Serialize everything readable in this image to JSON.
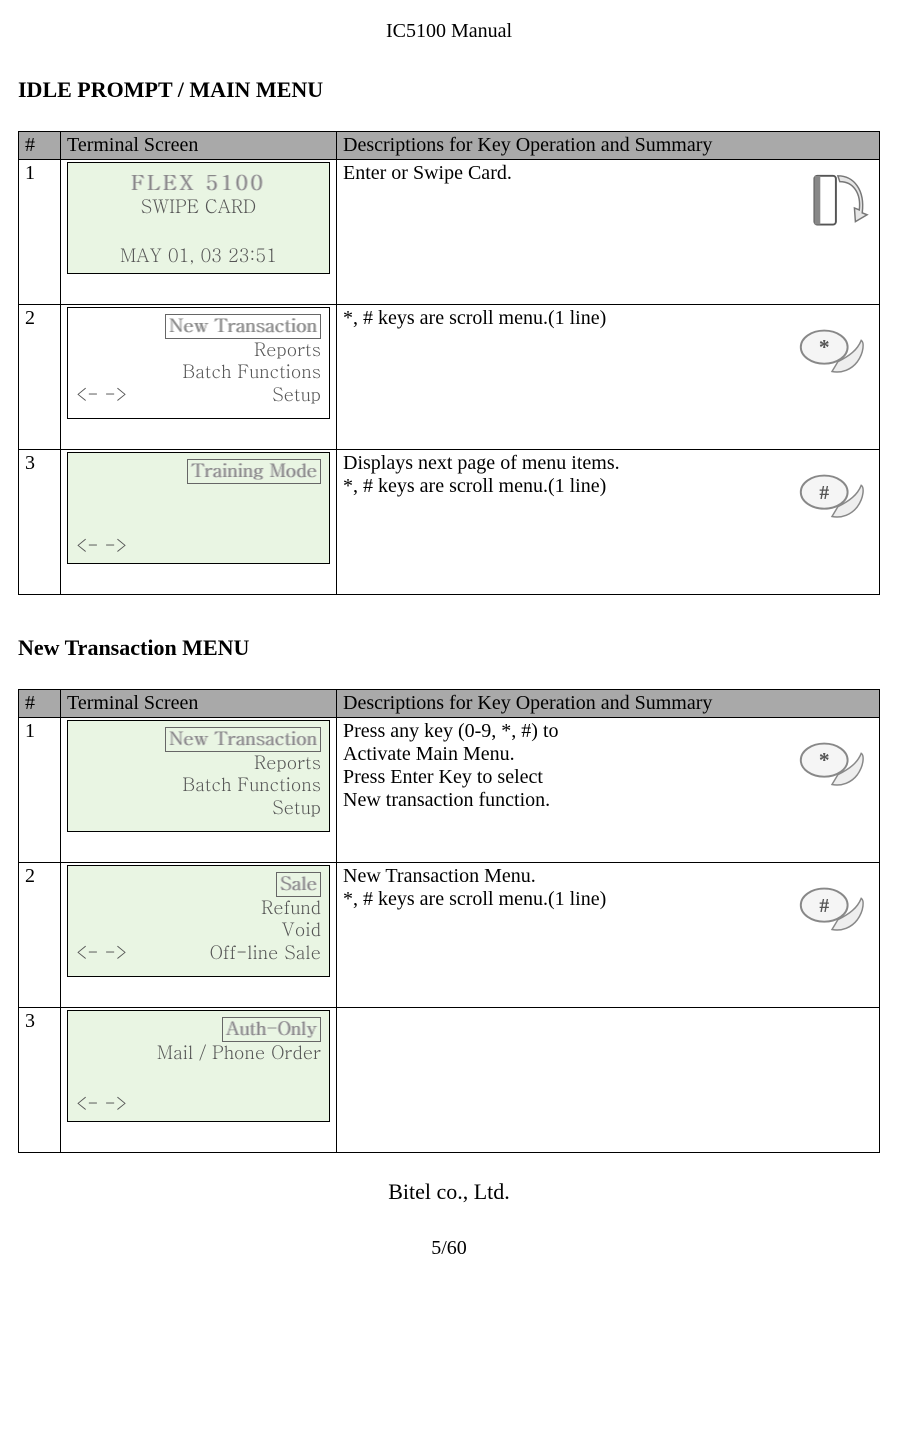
{
  "doc_title": "IC5100 Manual",
  "section1": {
    "heading": "IDLE PROMPT / MAIN MENU",
    "header": {
      "num": "#",
      "screen": "Terminal Screen",
      "desc": "Descriptions for Key Operation and Summary"
    },
    "rows": [
      {
        "num": "1",
        "screen": {
          "l1": "FLEX 5100",
          "l2": "SWIPE CARD",
          "l4": "MAY 01, 03 23:51"
        },
        "desc": "Enter or Swipe Card.",
        "icon": "swipe"
      },
      {
        "num": "2",
        "screen": {
          "hl": "New Transaction",
          "l2": "Reports",
          "l3": "Batch Functions",
          "nav_l": "<-   ->",
          "nav_r": "Setup"
        },
        "desc": "*, # keys are scroll menu.(1 line)",
        "icon": "star"
      },
      {
        "num": "3",
        "screen": {
          "hl": "Training Mode",
          "nav_l": "<-   ->"
        },
        "desc": "Displays next page of menu items.\n*, # keys are scroll menu.(1 line)",
        "icon": "hash"
      }
    ]
  },
  "section2": {
    "heading": "New Transaction MENU",
    "header": {
      "num": "#",
      "screen": "Terminal Screen",
      "desc": "Descriptions for Key Operation and Summary"
    },
    "rows": [
      {
        "num": "1",
        "screen": {
          "hl": "New Transaction",
          "l2": "Reports",
          "l3": "Batch Functions",
          "l4": "Setup"
        },
        "desc": "Press any key (0-9,  *, #) to\nActivate Main Menu.\nPress Enter Key to select\nNew transaction function.",
        "icon": "star"
      },
      {
        "num": "2",
        "screen": {
          "hl": "Sale",
          "l2": "Refund",
          "l3": "Void",
          "nav_l": "<-   ->",
          "nav_r": "Off-line Sale"
        },
        "desc": "New Transaction Menu.\n*, # keys are scroll menu.(1 line)",
        "icon": "hash"
      },
      {
        "num": "3",
        "screen": {
          "hl": "Auth-Only",
          "l2": "Mail / Phone Order",
          "nav_l": "<-   ->"
        },
        "desc": "",
        "icon": "none"
      }
    ]
  },
  "footer_company": "Bitel co., Ltd.",
  "pager": "5/60"
}
